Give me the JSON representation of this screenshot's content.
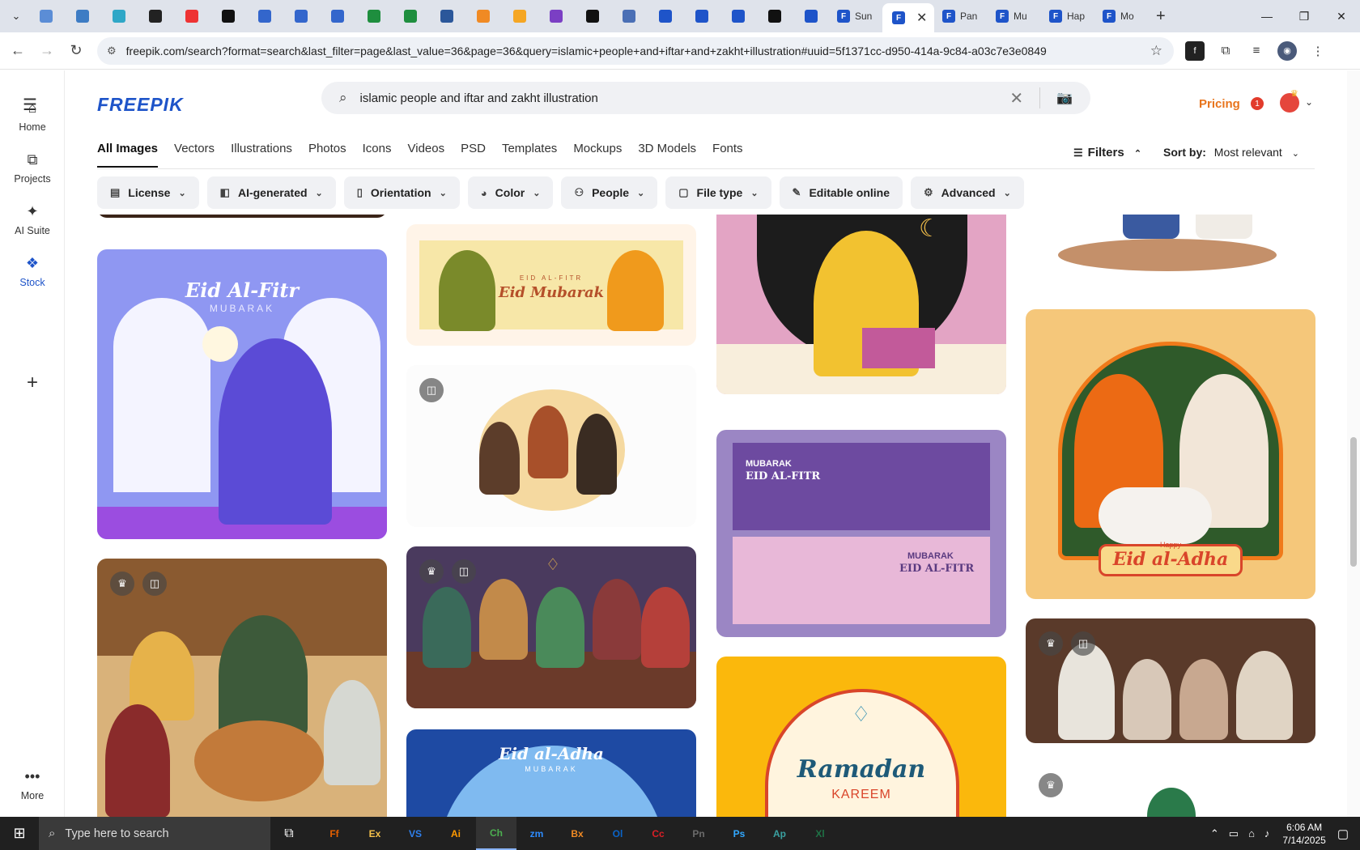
{
  "browser": {
    "tabs": [
      {
        "icon": "tab-list-icon"
      },
      {
        "icon": "edge-icon",
        "color": "#5b8dd6"
      },
      {
        "icon": "globe-icon",
        "color": "#3d7cc4"
      },
      {
        "icon": "arrow-icon",
        "color": "#2fa7c7"
      },
      {
        "icon": "openai-icon",
        "color": "#222222"
      },
      {
        "icon": "youtube-icon",
        "color": "#e33"
      },
      {
        "icon": "bolt-icon",
        "color": "#111111"
      },
      {
        "icon": "doc-icon",
        "color": "#3366cc"
      },
      {
        "icon": "doc-icon",
        "color": "#3366cc"
      },
      {
        "icon": "doc-icon",
        "color": "#3366cc"
      },
      {
        "icon": "sheet-icon",
        "color": "#1e8e3e"
      },
      {
        "icon": "sheet-icon",
        "color": "#1e8e3e"
      },
      {
        "icon": "word-icon",
        "color": "#2b579a"
      },
      {
        "icon": "box-icon",
        "color": "#f08a24"
      },
      {
        "icon": "spark-icon",
        "color": "#f5a623"
      },
      {
        "icon": "brace-icon",
        "color": "#7b3fc4"
      },
      {
        "icon": "a-icon",
        "color": "#111111"
      },
      {
        "icon": "grid-icon",
        "color": "#4a6fb5"
      },
      {
        "icon": "freepik-icon",
        "color": "#1e54c9"
      },
      {
        "icon": "freepik-icon",
        "color": "#1e54c9"
      },
      {
        "icon": "freepik-icon",
        "color": "#1e54c9"
      },
      {
        "icon": "m-icon",
        "color": "#111111"
      },
      {
        "icon": "freepik-icon",
        "color": "#1e54c9"
      }
    ],
    "named_tabs": [
      {
        "label": "Sun",
        "active": false
      },
      {
        "label": "",
        "active": true
      },
      {
        "label": "Pan",
        "active": false
      },
      {
        "label": "Mu",
        "active": false
      },
      {
        "label": "Hap",
        "active": false
      },
      {
        "label": "Mo",
        "active": false
      }
    ],
    "new_tab_label": "+",
    "url": "freepik.com/search?format=search&last_filter=page&last_value=36&page=36&query=islamic+people+and+iftar+and+zakht+illustration#uuid=5f1371cc-d950-414a-9c84-a03c7e3e0849"
  },
  "app": {
    "logo": "FREEPIK",
    "search": {
      "value": "islamic people and iftar and zakht illustration"
    },
    "pricing": "Pricing",
    "notification_count": "1"
  },
  "sidebar": [
    {
      "label": "Home",
      "icon": "home-icon"
    },
    {
      "label": "Projects",
      "icon": "projects-icon"
    },
    {
      "label": "AI Suite",
      "icon": "sparkle-icon"
    },
    {
      "label": "Stock",
      "icon": "stock-icon"
    },
    {
      "label": "",
      "icon": "plus-icon"
    },
    {
      "label": "More",
      "icon": "more-icon"
    }
  ],
  "categories": [
    "All Images",
    "Vectors",
    "Illustrations",
    "Photos",
    "Icons",
    "Videos",
    "PSD",
    "Templates",
    "Mockups",
    "3D Models",
    "Fonts"
  ],
  "filters_label": "Filters",
  "sort": {
    "label": "Sort by:",
    "value": "Most relevant"
  },
  "chips": [
    {
      "label": "License",
      "icon": "license-icon"
    },
    {
      "label": "AI-generated",
      "icon": "ai-icon"
    },
    {
      "label": "Orientation",
      "icon": "orientation-icon"
    },
    {
      "label": "Color",
      "icon": "palette-icon"
    },
    {
      "label": "People",
      "icon": "people-icon"
    },
    {
      "label": "File type",
      "icon": "file-icon"
    },
    {
      "label": "Editable online",
      "icon": "pencil-icon"
    },
    {
      "label": "Advanced",
      "icon": "gear-icon"
    }
  ],
  "cards": {
    "eid_fitr": {
      "title": "Eid Al-Fitr",
      "sub": "MUBARAK"
    },
    "eid_mubarak": {
      "title": "Eid Mubarak",
      "sub": "EID AL-FITR"
    },
    "mubarak_banner": {
      "line1": "MUBARAK",
      "line2": "EID AL-FITR",
      "line3": "MUBARAK",
      "line4": "EID AL-FITR"
    },
    "eid_adha": {
      "small": "Happy",
      "title": "Eid al-Adha"
    },
    "eid_adha_blue": {
      "title": "Eid al-Adha",
      "sub": "MUBARAK"
    },
    "ramadan": {
      "title": "Ramadan",
      "sub": "KAREEM"
    }
  },
  "taskbar": {
    "search_placeholder": "Type here to search",
    "apps": [
      "Ff",
      "Ex",
      "VS",
      "Ai",
      "Ch",
      "zm",
      "Bx",
      "Ol",
      "Cc",
      "Pn",
      "Ps",
      "Ap",
      "Xl"
    ],
    "time": "6:06 AM",
    "date": "7/14/2025"
  }
}
